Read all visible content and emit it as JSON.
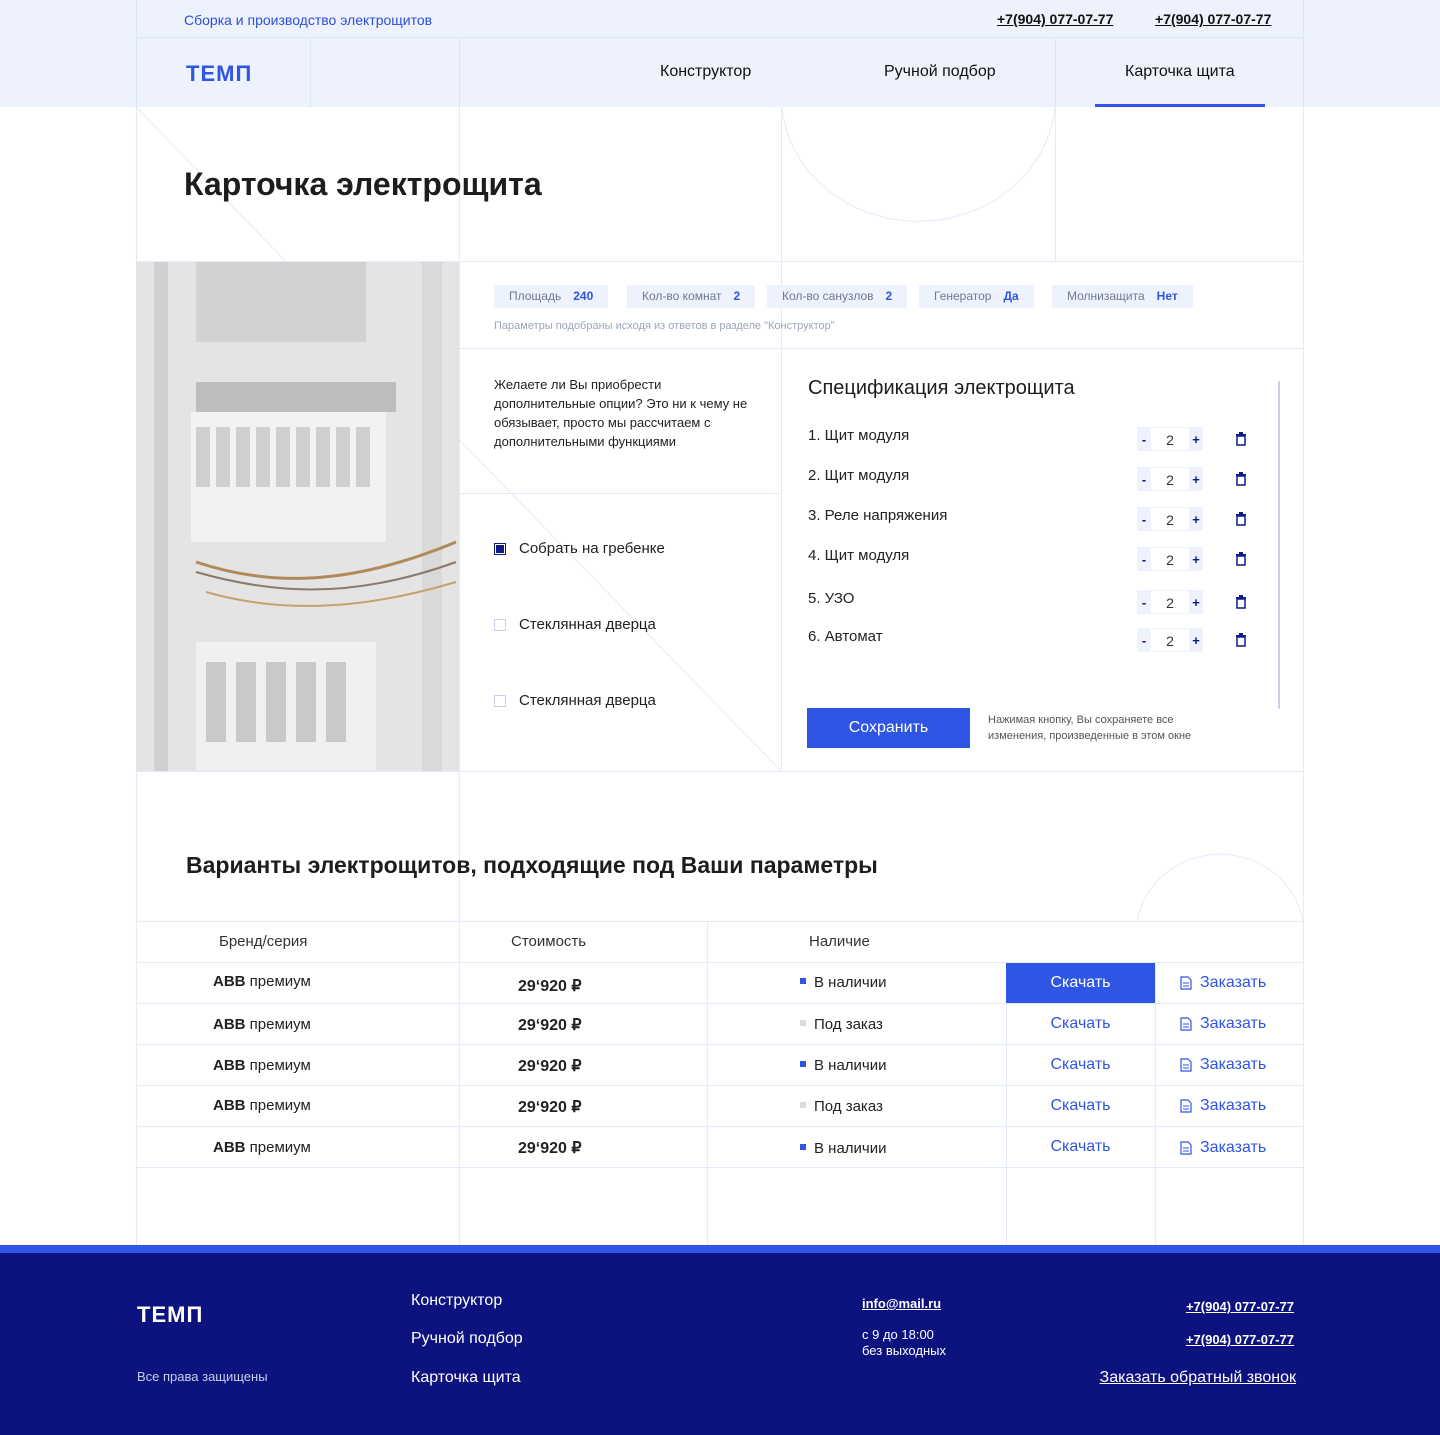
{
  "header": {
    "tagline": "Сборка и производство электрощитов",
    "phones": [
      "+7(904) 077-07-77",
      "+7(904) 077-07-77"
    ],
    "logo": "ТЕМП",
    "nav": [
      "Конструктор",
      "Ручной подбор",
      "Карточка щита"
    ],
    "active_nav": "Карточка щита"
  },
  "page_title": "Карточка электрощита",
  "params": [
    {
      "label": "Площадь",
      "value": "240"
    },
    {
      "label": "Кол-во комнат",
      "value": "2"
    },
    {
      "label": "Кол-во санузлов",
      "value": "2"
    },
    {
      "label": "Генератор",
      "value": "Да"
    },
    {
      "label": "Молнизащита",
      "value": "Нет"
    }
  ],
  "params_note": "Параметры подобраны исходя из ответов в разделе \"Конструктор\"",
  "options_question": "Желаете ли Вы приобрести дополнительные опции? Это ни к чему не обязывает, просто мы рассчитаем с дополнительными функциями",
  "options": [
    {
      "label": "Собрать на гребенке",
      "checked": true
    },
    {
      "label": "Стеклянная дверца",
      "checked": false
    },
    {
      "label": "Стеклянная дверца",
      "checked": false
    }
  ],
  "spec": {
    "title": "Спецификация электрощита",
    "items": [
      {
        "name": "1. Щит модуля",
        "qty": "2"
      },
      {
        "name": "2. Щит модуля",
        "qty": "2"
      },
      {
        "name": "3. Реле напряжения",
        "qty": "2"
      },
      {
        "name": "4. Щит модуля",
        "qty": "2"
      },
      {
        "name": "5. УЗО",
        "qty": "2"
      },
      {
        "name": "6. Автомат",
        "qty": "2"
      }
    ],
    "minus": "-",
    "plus": "+",
    "save_label": "Сохранить",
    "save_note": "Нажимая кнопку, Вы сохраняете все изменения, произведенные в этом окне"
  },
  "variants": {
    "title": "Варианты электрощитов, подходящие под Ваши параметры",
    "columns": [
      "Бренд/серия",
      "Стоимость",
      "Наличие"
    ],
    "rows": [
      {
        "brand": "ABB",
        "series": "премиум",
        "price": "29‘920 ₽",
        "status": "В наличии",
        "in_stock": true
      },
      {
        "brand": "ABB",
        "series": "премиум",
        "price": "29‘920 ₽",
        "status": "Под заказ",
        "in_stock": false
      },
      {
        "brand": "ABB",
        "series": "премиум",
        "price": "29‘920 ₽",
        "status": "В наличии",
        "in_stock": true
      },
      {
        "brand": "ABB",
        "series": "премиум",
        "price": "29‘920 ₽",
        "status": "Под заказ",
        "in_stock": false
      },
      {
        "brand": "ABB",
        "series": "премиум",
        "price": "29‘920 ₽",
        "status": "В наличии",
        "in_stock": true
      }
    ],
    "download_label": "Скачать",
    "order_label": "Заказать"
  },
  "footer": {
    "logo": "ТЕМП",
    "rights": "Все права защищены",
    "links": [
      "Конструктор",
      "Ручной подбор",
      "Карточка щита"
    ],
    "email": "info@mail.ru",
    "hours_line1": "с 9 до 18:00",
    "hours_line2": "без выходных",
    "phones": [
      "+7(904) 077-07-77",
      "+7(904) 077-07-77"
    ],
    "callback": "Заказать обратный звонок"
  },
  "colors": {
    "accent": "#2f55e4",
    "dark": "#0c137f",
    "light_bg": "#edf2fd",
    "in_stock": "#2f55e4",
    "on_order": "#d9dbe0"
  }
}
